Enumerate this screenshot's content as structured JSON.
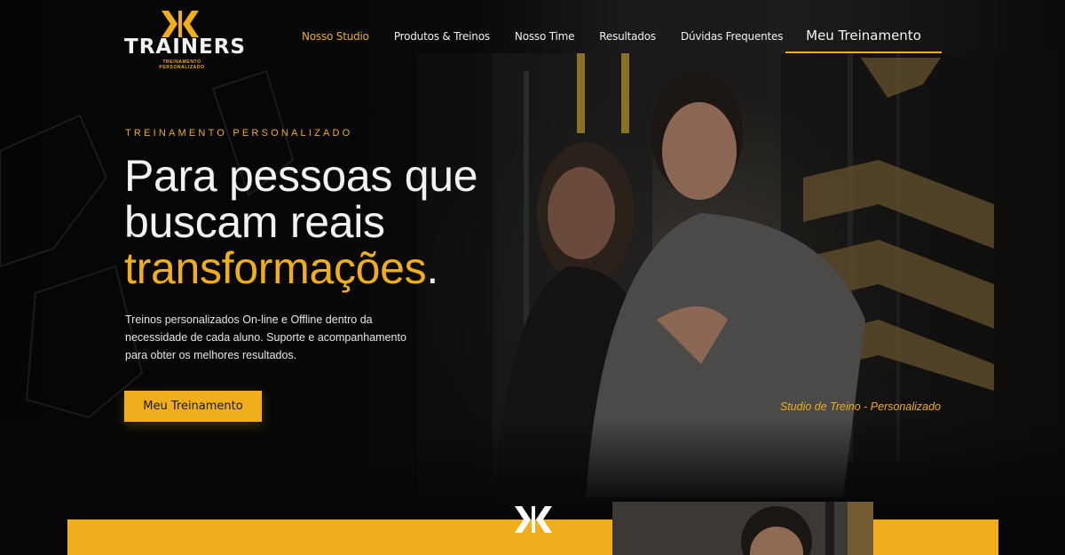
{
  "brand": {
    "name": "TRAINERS",
    "tagline": "TREINAMENTO PERSONALIZADO",
    "accent_color": "#f0ae1d"
  },
  "nav": {
    "items": [
      {
        "label": "Nosso Studio",
        "active": true
      },
      {
        "label": "Produtos & Treinos",
        "active": false
      },
      {
        "label": "Nosso Time",
        "active": false
      },
      {
        "label": "Resultados",
        "active": false
      },
      {
        "label": "Dúvidas Frequentes",
        "active": false
      }
    ],
    "cta_label": "Meu Treinamento"
  },
  "hero": {
    "eyebrow": "TREINAMENTO PERSONALIZADO",
    "headline_line1": "Para pessoas que",
    "headline_line2": "buscam reais",
    "headline_accent": "transformações",
    "headline_end": ".",
    "lead": "Treinos personalizados On-line e Offline dentro da necessidade de cada aluno. Suporte e acompanhamento para obter os melhores resultados.",
    "cta_label": "Meu Treinamento",
    "caption": "Studio de Treino - Personalizado"
  },
  "icons": {
    "logo": "kk-monogram-logo",
    "band_logo": "kk-monogram-logo"
  }
}
